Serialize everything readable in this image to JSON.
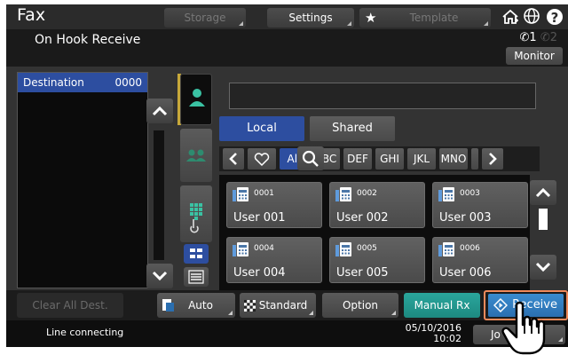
{
  "topbar": {
    "title": "Fax",
    "storage_label": "Storage",
    "settings_label": "Settings",
    "template_label": "Template",
    "icons": [
      "star-icon",
      "home-icon",
      "globe-icon",
      "help-icon"
    ],
    "help_glyph": "?"
  },
  "header": {
    "subtitle": "On Hook Receive",
    "line1": "1",
    "line2": "2",
    "monitor_label": "Monitor"
  },
  "destination": {
    "label": "Destination",
    "count": "0000"
  },
  "address_book": {
    "tabs": [
      "Local",
      "Shared"
    ],
    "index": [
      "All",
      "ABC",
      "DEF",
      "GHI",
      "JKL",
      "MNO"
    ],
    "entries": [
      {
        "num": "0001",
        "name": "User 001"
      },
      {
        "num": "0002",
        "name": "User 002"
      },
      {
        "num": "0003",
        "name": "User 003"
      },
      {
        "num": "0004",
        "name": "User 004"
      },
      {
        "num": "0005",
        "name": "User 005"
      },
      {
        "num": "0006",
        "name": "User 006"
      }
    ]
  },
  "functions": {
    "clear_label": "Clear All Dest.",
    "auto_label": "Auto",
    "standard_label": "Standard",
    "option_label": "Option",
    "manual_label": "Manual Rx",
    "receive_label": "Receive"
  },
  "status": {
    "message": "Line connecting",
    "date": "05/10/2016",
    "time": "10:02",
    "job_label": "Jo"
  },
  "colors": {
    "accent_blue": "#2d4ea0",
    "teal": "#1d8a81",
    "highlight": "#f08a5b",
    "gold": "#c7a83a"
  }
}
